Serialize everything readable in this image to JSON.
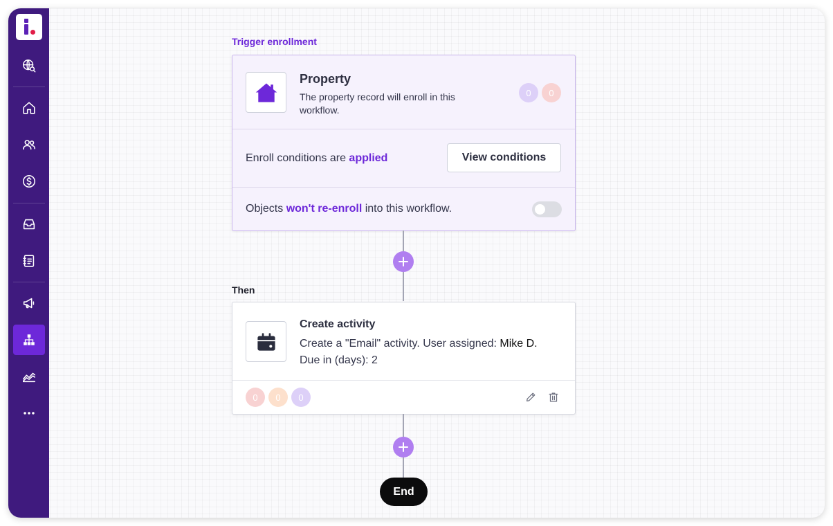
{
  "sidebar": {
    "logo": "i",
    "items": [
      {
        "icon": "globe-search-icon"
      },
      {
        "icon": "home-icon"
      },
      {
        "icon": "contacts-icon"
      },
      {
        "icon": "dollar-icon"
      },
      {
        "icon": "inbox-icon"
      },
      {
        "icon": "address-book-icon"
      },
      {
        "icon": "megaphone-icon"
      },
      {
        "icon": "workflow-icon",
        "active": true
      },
      {
        "icon": "reports-icon"
      },
      {
        "icon": "more-icon"
      }
    ]
  },
  "trigger": {
    "section_label": "Trigger enrollment",
    "icon": "house-icon",
    "title": "Property",
    "description": "The property record will enroll in this workflow.",
    "counters": [
      "0",
      "0"
    ],
    "conditions_prefix": "Enroll conditions are ",
    "conditions_status": "applied",
    "view_conditions_label": "View conditions",
    "reenroll_prefix": "Objects ",
    "reenroll_status": "won't re-enroll",
    "reenroll_suffix": " into this workflow.",
    "reenroll_enabled": false
  },
  "action_section_label": "Then",
  "action": {
    "icon": "calendar-icon",
    "title": "Create activity",
    "description_prefix": "Create a \"Email\" activity. User assigned: ",
    "assigned_user": "Mike D.",
    "due_text": "Due in (days): 2",
    "counters": [
      "0",
      "0",
      "0"
    ]
  },
  "end_label": "End",
  "colors": {
    "sidebar": "#3f1a7e",
    "accent": "#6d28d9",
    "plus_button": "#b07ef0",
    "trigger_bg": "#f6f2fd"
  }
}
